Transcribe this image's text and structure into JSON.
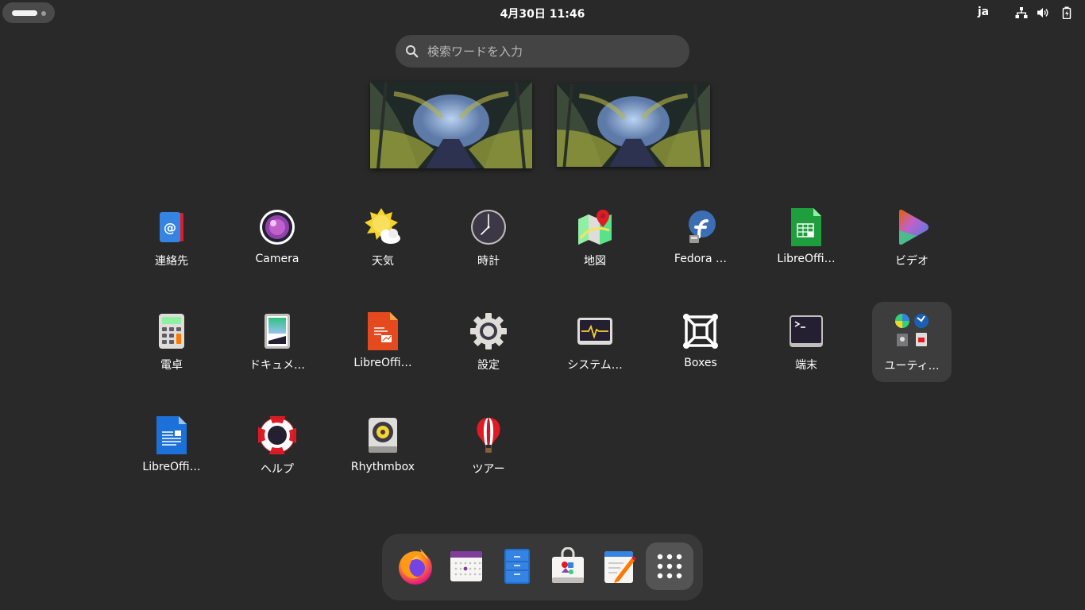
{
  "topbar": {
    "activities_icon": "activities-indicator",
    "clock": "4月30日  11:46",
    "language": "ja",
    "tray": [
      "network-icon",
      "volume-icon",
      "battery-icon"
    ]
  },
  "search": {
    "placeholder": "検索ワードを入力",
    "value": ""
  },
  "workspaces": [
    {
      "name": "workspace-1"
    },
    {
      "name": "workspace-2"
    }
  ],
  "apps": [
    {
      "label": "連絡先",
      "icon": "contacts-icon"
    },
    {
      "label": "Camera",
      "icon": "camera-icon"
    },
    {
      "label": "天気",
      "icon": "weather-icon"
    },
    {
      "label": "時計",
      "icon": "clock-icon"
    },
    {
      "label": "地図",
      "icon": "maps-icon"
    },
    {
      "label": "Fedora …",
      "icon": "fedora-media-writer-icon"
    },
    {
      "label": "LibreOffi…",
      "icon": "libreoffice-calc-icon"
    },
    {
      "label": "ビデオ",
      "icon": "videos-icon"
    },
    {
      "label": "電卓",
      "icon": "calculator-icon"
    },
    {
      "label": "ドキュメ…",
      "icon": "document-scanner-icon"
    },
    {
      "label": "LibreOffi…",
      "icon": "libreoffice-impress-icon"
    },
    {
      "label": "設定",
      "icon": "settings-gear-icon"
    },
    {
      "label": "システム…",
      "icon": "system-monitor-icon"
    },
    {
      "label": "Boxes",
      "icon": "boxes-icon"
    },
    {
      "label": "端末",
      "icon": "terminal-icon"
    },
    {
      "label": "ユーティ…",
      "icon": "utilities-folder-icon"
    },
    {
      "label": "LibreOffi…",
      "icon": "libreoffice-writer-icon"
    },
    {
      "label": "ヘルプ",
      "icon": "help-lifebuoy-icon"
    },
    {
      "label": "Rhythmbox",
      "icon": "rhythmbox-icon"
    },
    {
      "label": "ツアー",
      "icon": "tour-balloon-icon"
    }
  ],
  "dock": [
    "firefox-icon",
    "calendar-icon",
    "files-icon",
    "software-icon",
    "text-editor-icon",
    "show-apps-grid-icon"
  ]
}
